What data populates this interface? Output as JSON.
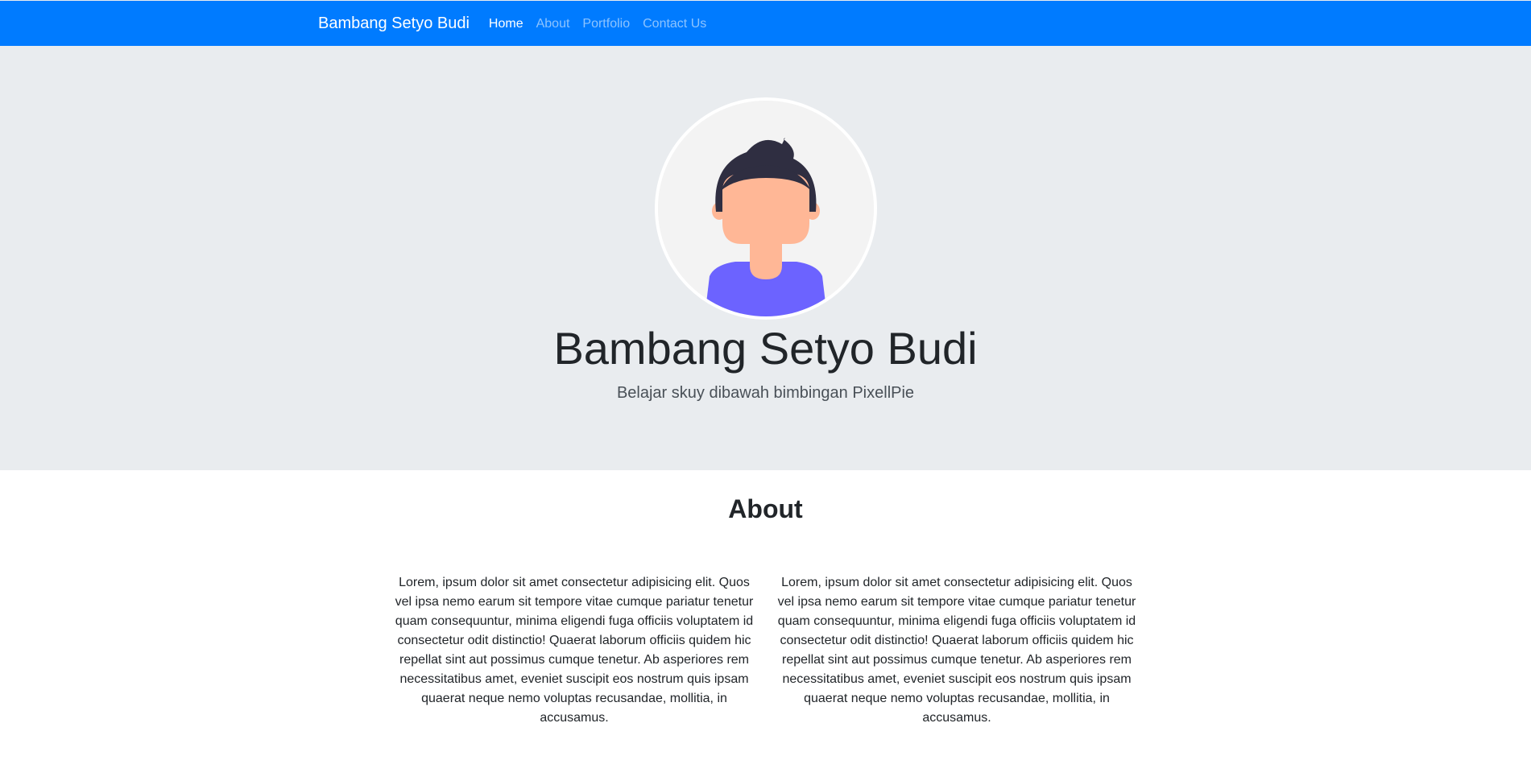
{
  "navbar": {
    "brand": "Bambang Setyo Budi",
    "links": [
      {
        "label": "Home",
        "active": true
      },
      {
        "label": "About",
        "active": false
      },
      {
        "label": "Portfolio",
        "active": false
      },
      {
        "label": "Contact Us",
        "active": false
      }
    ],
    "background": "#007bff"
  },
  "hero": {
    "avatar_icon": "user-avatar-illustration",
    "name": "Bambang Setyo Budi",
    "tagline": "Belajar skuy dibawah bimbingan PixellPie",
    "background": "#e9ecef"
  },
  "about": {
    "title": "About",
    "paragraphs": [
      "Lorem, ipsum dolor sit amet consectetur adipisicing elit. Quos vel ipsa nemo earum sit tempore vitae cumque pariatur tenetur quam consequuntur, minima eligendi fuga officiis voluptatem id consectetur odit distinctio! Quaerat laborum officiis quidem hic repellat sint aut possimus cumque tenetur. Ab asperiores rem necessitatibus amet, eveniet suscipit eos nostrum quis ipsam quaerat neque nemo voluptas recusandae, mollitia, in accusamus.",
      "Lorem, ipsum dolor sit amet consectetur adipisicing elit. Quos vel ipsa nemo earum sit tempore vitae cumque pariatur tenetur quam consequuntur, minima eligendi fuga officiis voluptatem id consectetur odit distinctio! Quaerat laborum officiis quidem hic repellat sint aut possimus cumque tenetur. Ab asperiores rem necessitatibus amet, eveniet suscipit eos nostrum quis ipsam quaerat neque nemo voluptas recusandae, mollitia, in accusamus."
    ]
  }
}
